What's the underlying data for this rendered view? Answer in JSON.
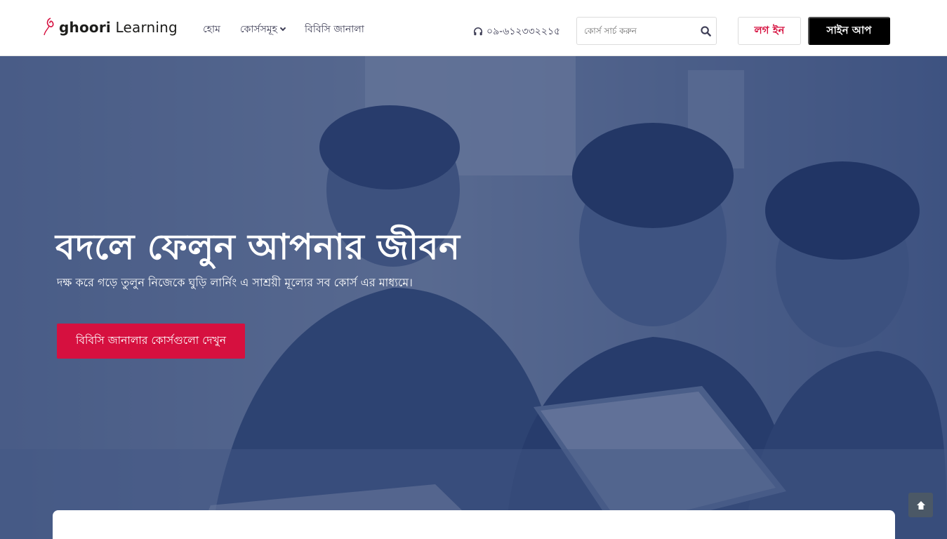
{
  "brand": {
    "logo_main": "ghoori",
    "logo_secondary": " Learning",
    "accent_color": "#d6103f"
  },
  "nav": {
    "items": [
      {
        "label": "হোম"
      },
      {
        "label": "কোর্সসমূহ"
      },
      {
        "label": "বিবিসি জানালা"
      }
    ],
    "phone": "০৯-৬১২৩৩২২১৫",
    "search_placeholder": "কোর্স সার্চ করুন",
    "login_label": "লগ ইন",
    "signup_label": "সাইন আপ"
  },
  "hero": {
    "title": "বদলে ফেলুন আপনার জীবন",
    "subtitle": "দক্ষ করে গড়ে তুলুন নিজেকে ঘুড়ি লার্নিং এ সাশ্রয়ী মূল্যের সব কোর্স এর মাধ্যমে।",
    "cta_label": "বিবিসি জানালার কোর্সগুলো দেখুন"
  },
  "icons": {
    "phone": "headphones-icon",
    "search": "search-icon",
    "dropdown": "chevron-down-icon",
    "scroll_top": "arrow-up-icon"
  }
}
